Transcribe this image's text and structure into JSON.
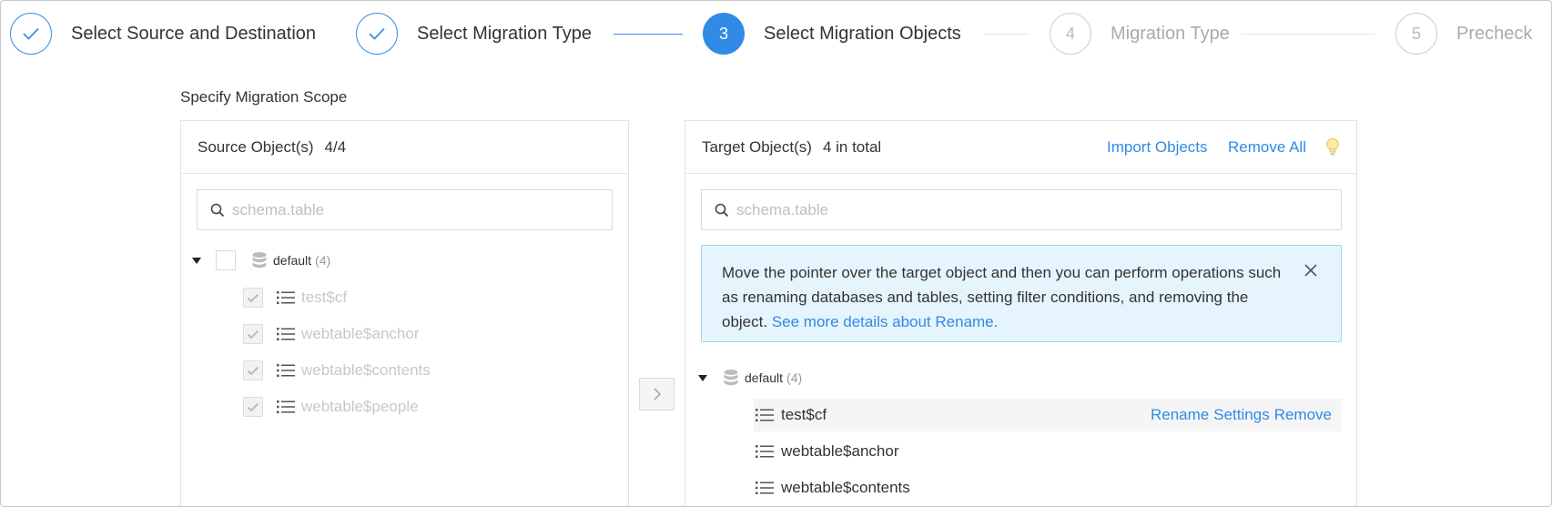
{
  "steps": [
    {
      "number": "",
      "label": "Select Source and Destination",
      "state": "done"
    },
    {
      "number": "",
      "label": "Select Migration Type",
      "state": "done"
    },
    {
      "number": "3",
      "label": "Select Migration Objects",
      "state": "active"
    },
    {
      "number": "4",
      "label": "Migration Type",
      "state": "todo"
    },
    {
      "number": "5",
      "label": "Precheck",
      "state": "todo"
    }
  ],
  "scope_title": "Specify Migration Scope",
  "source": {
    "title": "Source Object(s)",
    "count": "4/4",
    "search_placeholder": "schema.table",
    "database": {
      "name": "default",
      "count": "(4)"
    },
    "items": [
      "test$cf",
      "webtable$anchor",
      "webtable$contents",
      "webtable$people"
    ]
  },
  "transfer_button": ">",
  "target": {
    "title": "Target Object(s)",
    "count": "4 in total",
    "import_label": "Import Objects",
    "remove_all_label": "Remove All",
    "search_placeholder": "schema.table",
    "notice_text": "Move the pointer over the target object and then you can perform operations such as renaming databases and tables, setting filter conditions, and removing the object.",
    "notice_link": "See more details about Rename.",
    "database": {
      "name": "default",
      "count": "(4)"
    },
    "items": [
      "test$cf",
      "webtable$anchor",
      "webtable$contents"
    ],
    "row_actions": {
      "rename": "Rename",
      "settings": "Settings",
      "remove": "Remove"
    }
  },
  "colors": {
    "accent": "#2f8be6",
    "notice_bg": "#e6f4fd",
    "notice_border": "#9fd3f2"
  }
}
